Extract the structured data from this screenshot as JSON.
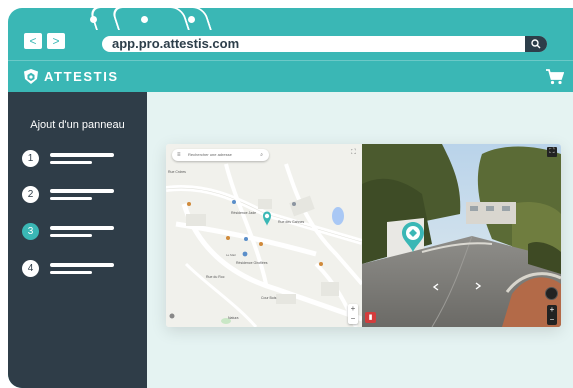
{
  "browser": {
    "back_icon": "<",
    "forward_icon": ">",
    "url": "app.pro.attestis.com",
    "search_icon": "search-icon"
  },
  "app": {
    "brand": "ATTESTIS",
    "logo_icon": "shield-logo-icon",
    "cart_icon": "cart-icon"
  },
  "sidebar": {
    "title": "Ajout d'un panneau",
    "steps": [
      {
        "number": "1",
        "active": false
      },
      {
        "number": "2",
        "active": false
      },
      {
        "number": "3",
        "active": true
      },
      {
        "number": "4",
        "active": false
      }
    ]
  },
  "map": {
    "search_placeholder": "Rechercher une adresse",
    "zoom_in": "+",
    "zoom_out": "−"
  },
  "streetview": {
    "zoom_in": "+",
    "zoom_out": "−"
  },
  "colors": {
    "accent": "#3ab7b5",
    "sidebar": "#2f3d48",
    "content_bg": "#e5f3f2"
  }
}
